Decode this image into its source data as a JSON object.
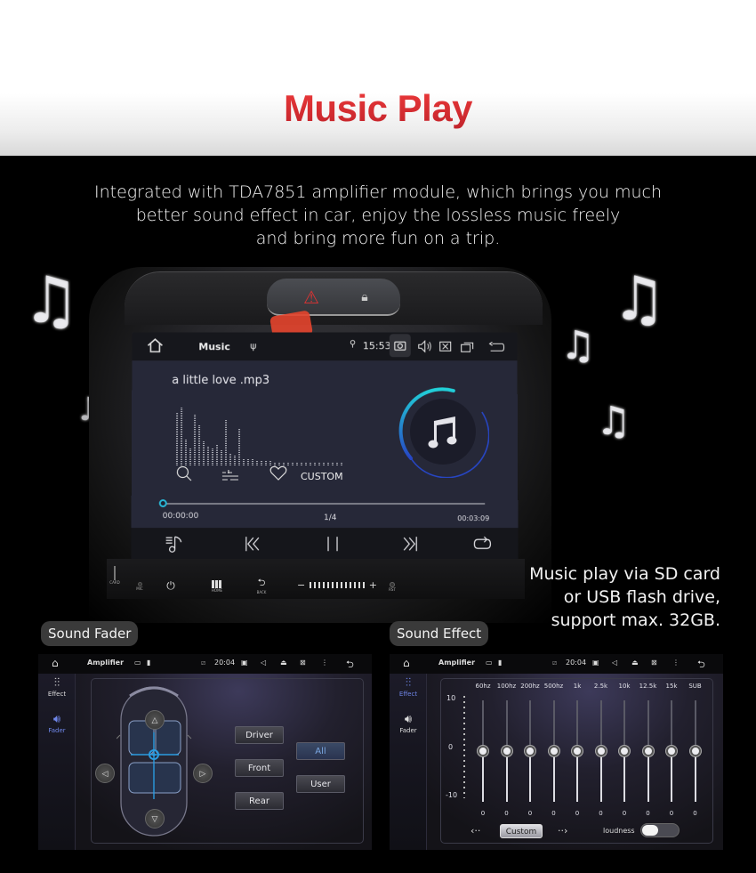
{
  "header": {
    "title": "Music Play",
    "title_color": "#d9232b",
    "intro_lines": [
      "Integrated with TDA7851 amplifier module, which brings you much",
      "better sound effect in car, enjoy the lossless music freely",
      "and bring more fun on a trip."
    ]
  },
  "music_app": {
    "status_bar": {
      "app_title": "Music",
      "time": "15:53",
      "icons": [
        "home-icon",
        "usb-icon",
        "location-icon",
        "camera-icon",
        "volume-icon",
        "close-app-icon",
        "recent-apps-icon",
        "back-icon"
      ]
    },
    "song_title": "a little love .mp3",
    "mode_label": "CUSTOM",
    "elapsed": "00:00:00",
    "track_counter": "1/4",
    "duration": "00:03:09",
    "progress": 0.0,
    "accent_color": "#28b7d6",
    "transport": [
      "playlist-icon",
      "previous-icon",
      "pause-icon",
      "next-icon",
      "repeat-icon"
    ]
  },
  "head_unit": {
    "labels": {
      "card": "CARD",
      "mic": "MIC",
      "home": "HOME",
      "back": "BACK",
      "rst": "RST"
    },
    "volume_minus": "−",
    "volume_plus": "+"
  },
  "side_caption": {
    "lines": [
      "Music play via SD card",
      "or USB flash drive,",
      "support max. 32GB."
    ]
  },
  "panels": {
    "fader": {
      "pill_label": "Sound Fader",
      "status_bar": {
        "app_title": "Amplifier",
        "time": "20:04"
      },
      "side_items": [
        {
          "label": "Effect",
          "active": false
        },
        {
          "label": "Fader",
          "active": true
        }
      ],
      "seat_buttons": [
        "Driver",
        "Front",
        "Rear"
      ],
      "mode_buttons": [
        {
          "label": "All",
          "active": true
        },
        {
          "label": "User",
          "active": false
        }
      ]
    },
    "effect": {
      "pill_label": "Sound Effect",
      "status_bar": {
        "app_title": "Amplifier",
        "time": "20:04"
      },
      "side_items": [
        {
          "label": "Effect",
          "active": true
        },
        {
          "label": "Fader",
          "active": false
        }
      ],
      "scale": {
        "max": "10",
        "mid": "0",
        "min": "-10"
      },
      "bands": [
        {
          "label": "60hz",
          "value": 0
        },
        {
          "label": "100hz",
          "value": 0
        },
        {
          "label": "200hz",
          "value": 0
        },
        {
          "label": "500hz",
          "value": 0
        },
        {
          "label": "1k",
          "value": 0
        },
        {
          "label": "2.5k",
          "value": 0
        },
        {
          "label": "10k",
          "value": 0
        },
        {
          "label": "12.5k",
          "value": 0
        },
        {
          "label": "15k",
          "value": 0
        },
        {
          "label": "SUB",
          "value": 0
        }
      ],
      "preset_label": "Custom",
      "loudness_label": "loudness",
      "loudness_on": false
    }
  }
}
